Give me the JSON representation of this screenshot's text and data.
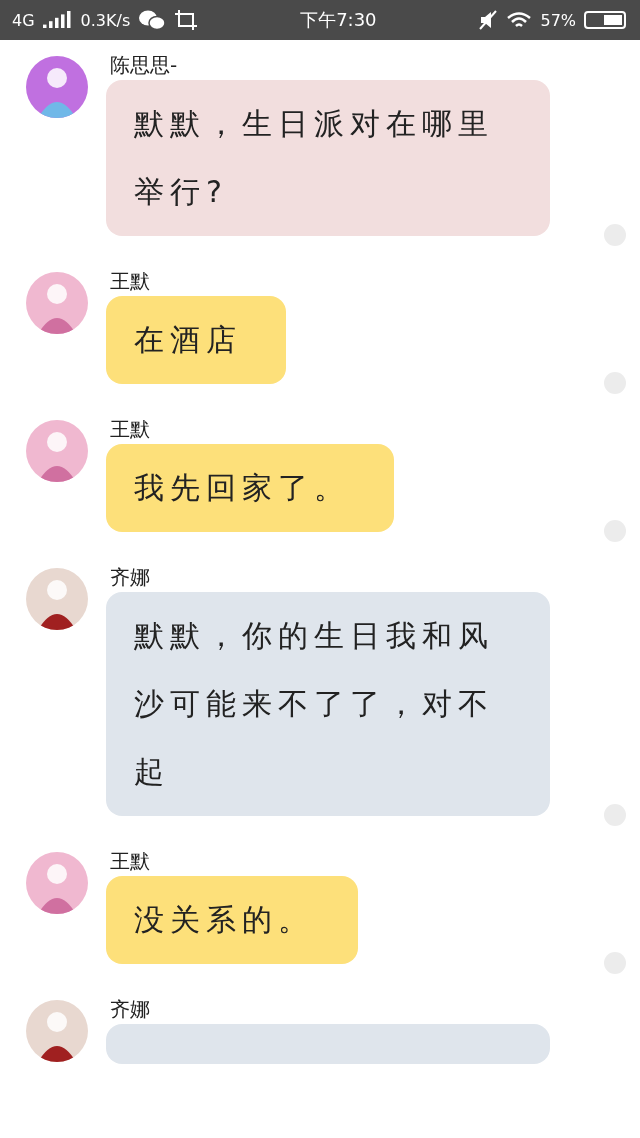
{
  "status_bar": {
    "network": "4G",
    "speed": "0.3K/s",
    "time": "下午7:30",
    "battery": "57%"
  },
  "messages": [
    {
      "sender": "陈思思-",
      "text": "默默，生日派对在哪里举行?",
      "color": "#f2dede"
    },
    {
      "sender": "王默",
      "text": "在酒店",
      "color": "#fde07a"
    },
    {
      "sender": "王默",
      "text": "我先回家了。",
      "color": "#fde07a"
    },
    {
      "sender": "齐娜",
      "text": "默默，你的生日我和风沙可能来不了了，对不起",
      "color": "#dfe5ec"
    },
    {
      "sender": "王默",
      "text": "没关系的。",
      "color": "#fde07a"
    },
    {
      "sender": "齐娜",
      "color": "#dfe5ec"
    }
  ]
}
